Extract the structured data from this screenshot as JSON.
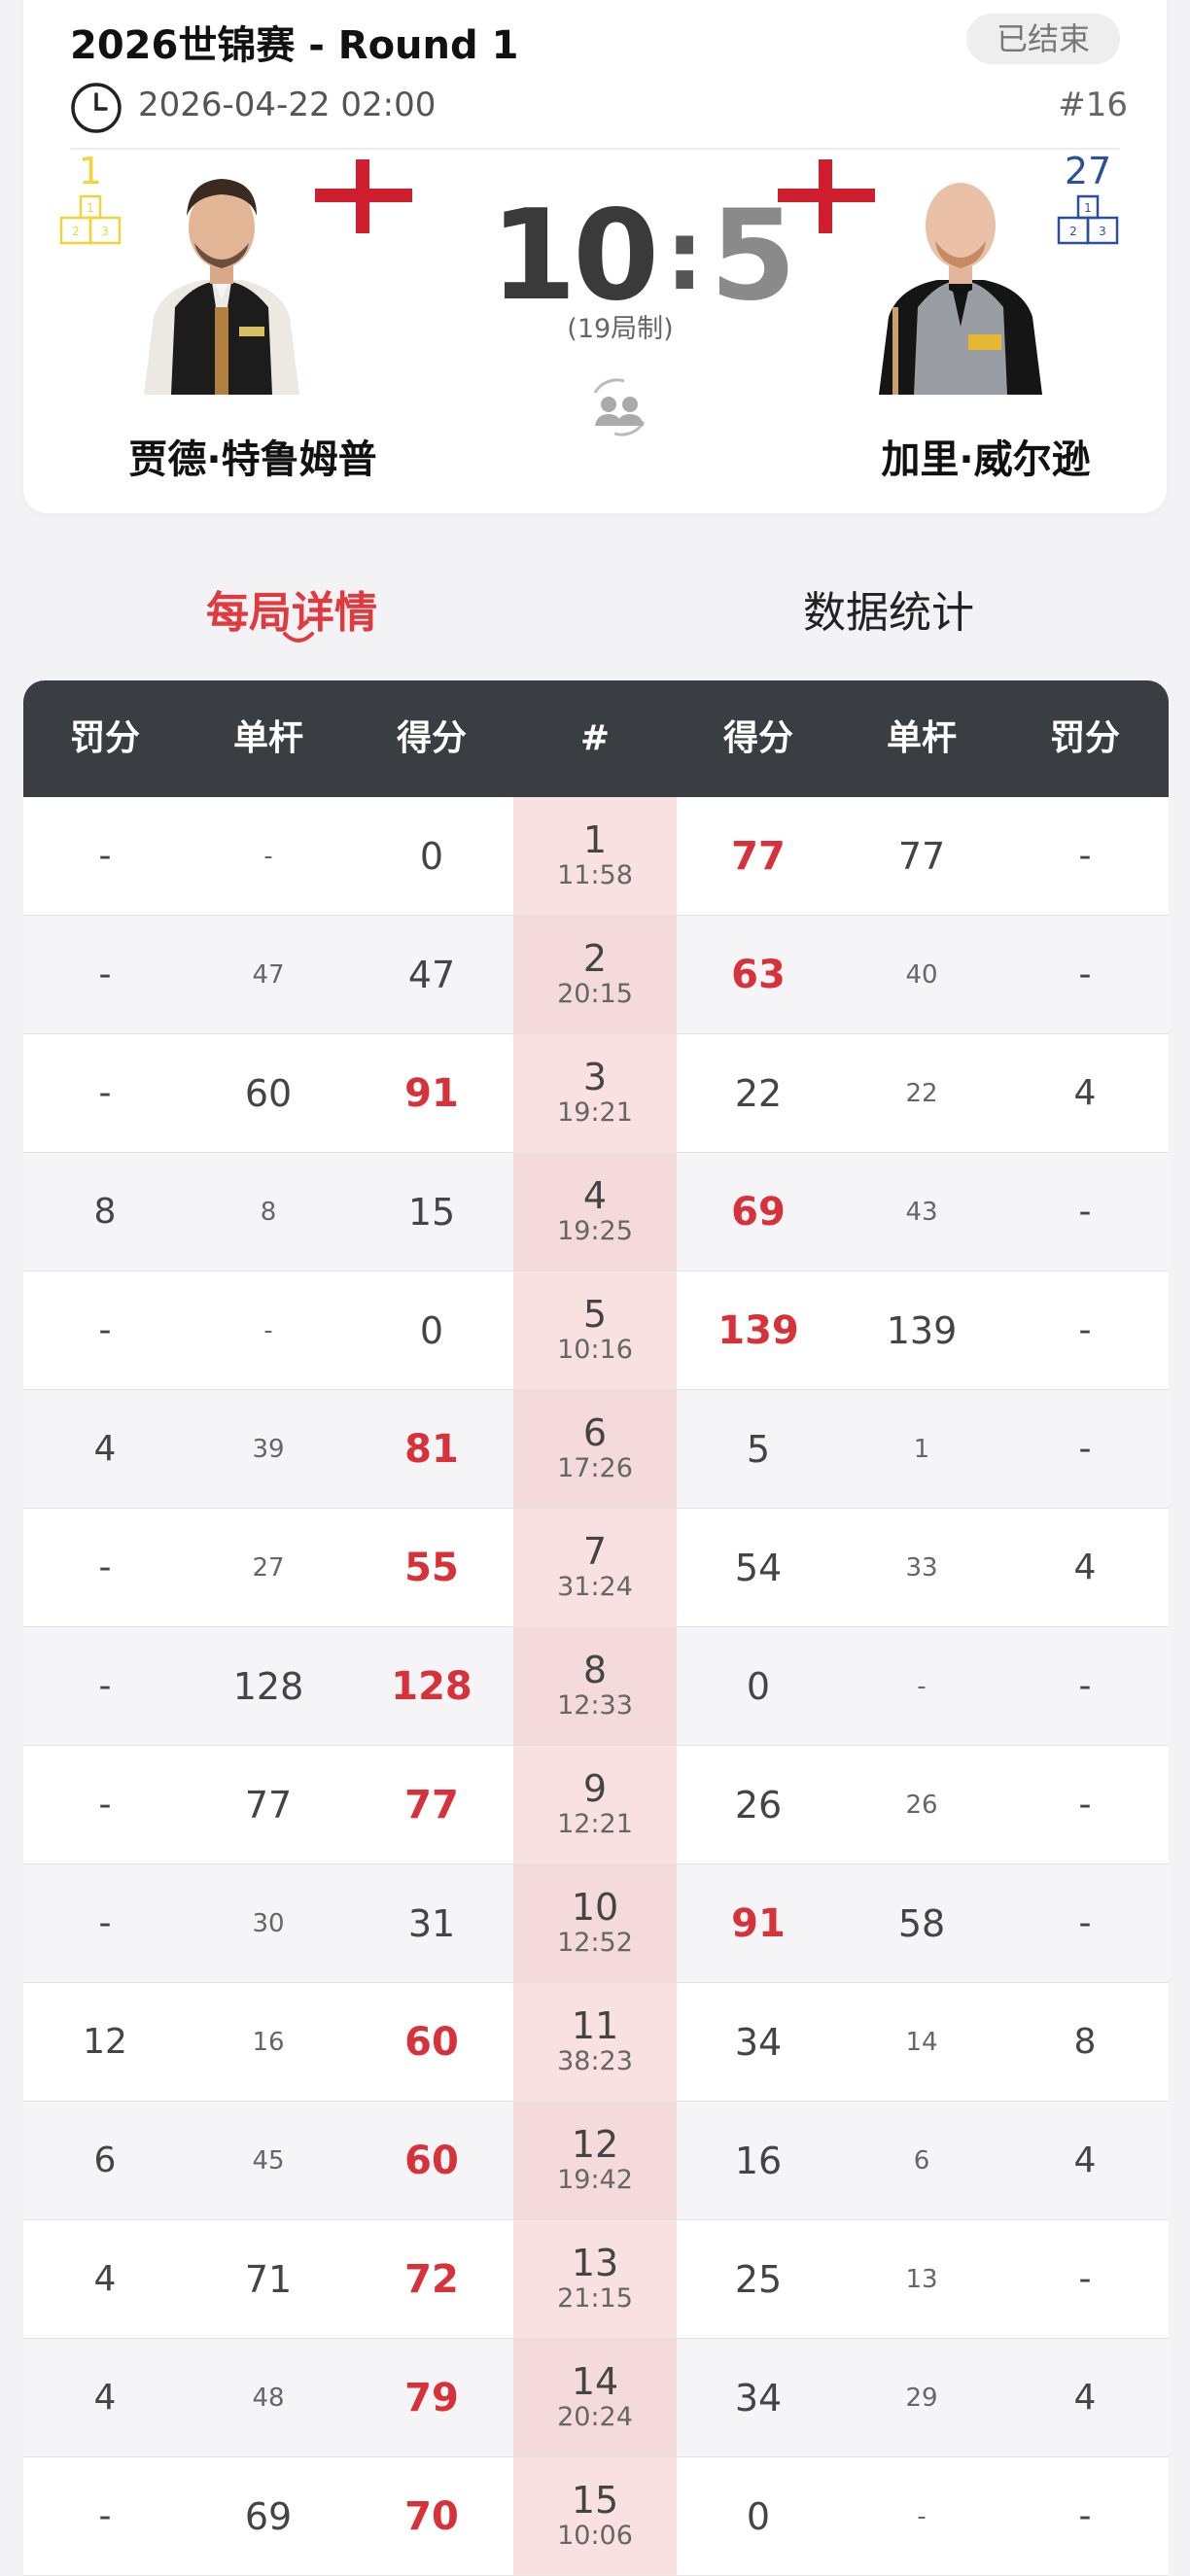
{
  "match": {
    "title": "2026世锦赛 - Round 1",
    "status": "已结束",
    "datetime": "2026-04-22 02:00",
    "match_no": "#16",
    "format": "(19局制)",
    "score_left": "10",
    "score_right": "5",
    "score_sep": ":"
  },
  "players": {
    "left": {
      "name": "贾德·特鲁姆普",
      "rank": "1",
      "rank_color": "#f2d33a",
      "flag": "england"
    },
    "right": {
      "name": "加里·威尔逊",
      "rank": "27",
      "rank_color": "#2c4fa0",
      "flag": "england"
    }
  },
  "tabs": {
    "active": "每局详情",
    "inactive": "数据统计"
  },
  "table": {
    "headers": [
      "罚分",
      "单杆",
      "得分",
      "#",
      "得分",
      "单杆",
      "罚分"
    ],
    "rows": [
      {
        "lp": "-",
        "lb": "-",
        "ls": "0",
        "n": "1",
        "t": "11:58",
        "rs": "77",
        "rb": "77",
        "rp": "-",
        "winner": "right",
        "lb_small": true,
        "rb_small": false
      },
      {
        "lp": "-",
        "lb": "47",
        "ls": "47",
        "n": "2",
        "t": "20:15",
        "rs": "63",
        "rb": "40",
        "rp": "-",
        "winner": "right",
        "lb_small": true,
        "rb_small": true
      },
      {
        "lp": "-",
        "lb": "60",
        "ls": "91",
        "n": "3",
        "t": "19:21",
        "rs": "22",
        "rb": "22",
        "rp": "4",
        "winner": "left",
        "lb_small": false,
        "rb_small": true
      },
      {
        "lp": "8",
        "lb": "8",
        "ls": "15",
        "n": "4",
        "t": "19:25",
        "rs": "69",
        "rb": "43",
        "rp": "-",
        "winner": "right",
        "lb_small": true,
        "rb_small": true
      },
      {
        "lp": "-",
        "lb": "-",
        "ls": "0",
        "n": "5",
        "t": "10:16",
        "rs": "139",
        "rb": "139",
        "rp": "-",
        "winner": "right",
        "lb_small": true,
        "rb_small": false
      },
      {
        "lp": "4",
        "lb": "39",
        "ls": "81",
        "n": "6",
        "t": "17:26",
        "rs": "5",
        "rb": "1",
        "rp": "-",
        "winner": "left",
        "lb_small": true,
        "rb_small": true
      },
      {
        "lp": "-",
        "lb": "27",
        "ls": "55",
        "n": "7",
        "t": "31:24",
        "rs": "54",
        "rb": "33",
        "rp": "4",
        "winner": "left",
        "lb_small": true,
        "rb_small": true
      },
      {
        "lp": "-",
        "lb": "128",
        "ls": "128",
        "n": "8",
        "t": "12:33",
        "rs": "0",
        "rb": "-",
        "rp": "-",
        "winner": "left",
        "lb_small": false,
        "rb_small": true
      },
      {
        "lp": "-",
        "lb": "77",
        "ls": "77",
        "n": "9",
        "t": "12:21",
        "rs": "26",
        "rb": "26",
        "rp": "-",
        "winner": "left",
        "lb_small": false,
        "rb_small": true
      },
      {
        "lp": "-",
        "lb": "30",
        "ls": "31",
        "n": "10",
        "t": "12:52",
        "rs": "91",
        "rb": "58",
        "rp": "-",
        "winner": "right",
        "lb_small": true,
        "rb_small": false
      },
      {
        "lp": "12",
        "lb": "16",
        "ls": "60",
        "n": "11",
        "t": "38:23",
        "rs": "34",
        "rb": "14",
        "rp": "8",
        "winner": "left",
        "lb_small": true,
        "rb_small": true
      },
      {
        "lp": "6",
        "lb": "45",
        "ls": "60",
        "n": "12",
        "t": "19:42",
        "rs": "16",
        "rb": "6",
        "rp": "4",
        "winner": "left",
        "lb_small": true,
        "rb_small": true
      },
      {
        "lp": "4",
        "lb": "71",
        "ls": "72",
        "n": "13",
        "t": "21:15",
        "rs": "25",
        "rb": "13",
        "rp": "-",
        "winner": "left",
        "lb_small": false,
        "rb_small": true
      },
      {
        "lp": "4",
        "lb": "48",
        "ls": "79",
        "n": "14",
        "t": "20:24",
        "rs": "34",
        "rb": "29",
        "rp": "4",
        "winner": "left",
        "lb_small": true,
        "rb_small": true
      },
      {
        "lp": "-",
        "lb": "69",
        "ls": "70",
        "n": "15",
        "t": "10:06",
        "rs": "0",
        "rb": "-",
        "rp": "-",
        "winner": "left",
        "lb_small": false,
        "rb_small": true
      }
    ]
  },
  "colors": {
    "accent": "#e03a3f",
    "win": "#d7313a",
    "header_bg": "#3a3d42",
    "frame_col": "#f9e1e2"
  },
  "icons": [
    "clock-icon",
    "podium-icon",
    "england-flag-icon",
    "head-to-head-icon"
  ]
}
